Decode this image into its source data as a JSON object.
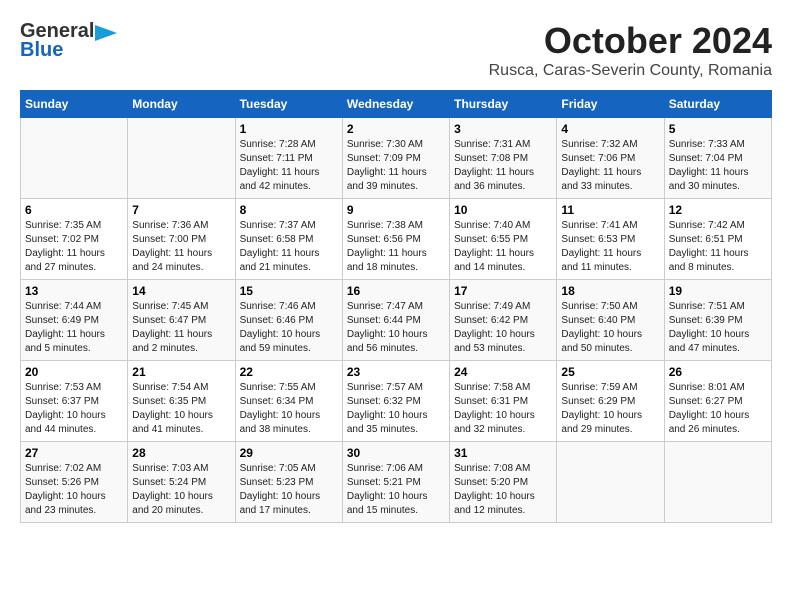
{
  "header": {
    "logo": {
      "line1": "General",
      "line2": "Blue"
    },
    "title": "October 2024",
    "subtitle": "Rusca, Caras-Severin County, Romania"
  },
  "weekdays": [
    "Sunday",
    "Monday",
    "Tuesday",
    "Wednesday",
    "Thursday",
    "Friday",
    "Saturday"
  ],
  "weeks": [
    [
      {
        "day": "",
        "info": ""
      },
      {
        "day": "",
        "info": ""
      },
      {
        "day": "1",
        "info": "Sunrise: 7:28 AM\nSunset: 7:11 PM\nDaylight: 11 hours and 42 minutes."
      },
      {
        "day": "2",
        "info": "Sunrise: 7:30 AM\nSunset: 7:09 PM\nDaylight: 11 hours and 39 minutes."
      },
      {
        "day": "3",
        "info": "Sunrise: 7:31 AM\nSunset: 7:08 PM\nDaylight: 11 hours and 36 minutes."
      },
      {
        "day": "4",
        "info": "Sunrise: 7:32 AM\nSunset: 7:06 PM\nDaylight: 11 hours and 33 minutes."
      },
      {
        "day": "5",
        "info": "Sunrise: 7:33 AM\nSunset: 7:04 PM\nDaylight: 11 hours and 30 minutes."
      }
    ],
    [
      {
        "day": "6",
        "info": "Sunrise: 7:35 AM\nSunset: 7:02 PM\nDaylight: 11 hours and 27 minutes."
      },
      {
        "day": "7",
        "info": "Sunrise: 7:36 AM\nSunset: 7:00 PM\nDaylight: 11 hours and 24 minutes."
      },
      {
        "day": "8",
        "info": "Sunrise: 7:37 AM\nSunset: 6:58 PM\nDaylight: 11 hours and 21 minutes."
      },
      {
        "day": "9",
        "info": "Sunrise: 7:38 AM\nSunset: 6:56 PM\nDaylight: 11 hours and 18 minutes."
      },
      {
        "day": "10",
        "info": "Sunrise: 7:40 AM\nSunset: 6:55 PM\nDaylight: 11 hours and 14 minutes."
      },
      {
        "day": "11",
        "info": "Sunrise: 7:41 AM\nSunset: 6:53 PM\nDaylight: 11 hours and 11 minutes."
      },
      {
        "day": "12",
        "info": "Sunrise: 7:42 AM\nSunset: 6:51 PM\nDaylight: 11 hours and 8 minutes."
      }
    ],
    [
      {
        "day": "13",
        "info": "Sunrise: 7:44 AM\nSunset: 6:49 PM\nDaylight: 11 hours and 5 minutes."
      },
      {
        "day": "14",
        "info": "Sunrise: 7:45 AM\nSunset: 6:47 PM\nDaylight: 11 hours and 2 minutes."
      },
      {
        "day": "15",
        "info": "Sunrise: 7:46 AM\nSunset: 6:46 PM\nDaylight: 10 hours and 59 minutes."
      },
      {
        "day": "16",
        "info": "Sunrise: 7:47 AM\nSunset: 6:44 PM\nDaylight: 10 hours and 56 minutes."
      },
      {
        "day": "17",
        "info": "Sunrise: 7:49 AM\nSunset: 6:42 PM\nDaylight: 10 hours and 53 minutes."
      },
      {
        "day": "18",
        "info": "Sunrise: 7:50 AM\nSunset: 6:40 PM\nDaylight: 10 hours and 50 minutes."
      },
      {
        "day": "19",
        "info": "Sunrise: 7:51 AM\nSunset: 6:39 PM\nDaylight: 10 hours and 47 minutes."
      }
    ],
    [
      {
        "day": "20",
        "info": "Sunrise: 7:53 AM\nSunset: 6:37 PM\nDaylight: 10 hours and 44 minutes."
      },
      {
        "day": "21",
        "info": "Sunrise: 7:54 AM\nSunset: 6:35 PM\nDaylight: 10 hours and 41 minutes."
      },
      {
        "day": "22",
        "info": "Sunrise: 7:55 AM\nSunset: 6:34 PM\nDaylight: 10 hours and 38 minutes."
      },
      {
        "day": "23",
        "info": "Sunrise: 7:57 AM\nSunset: 6:32 PM\nDaylight: 10 hours and 35 minutes."
      },
      {
        "day": "24",
        "info": "Sunrise: 7:58 AM\nSunset: 6:31 PM\nDaylight: 10 hours and 32 minutes."
      },
      {
        "day": "25",
        "info": "Sunrise: 7:59 AM\nSunset: 6:29 PM\nDaylight: 10 hours and 29 minutes."
      },
      {
        "day": "26",
        "info": "Sunrise: 8:01 AM\nSunset: 6:27 PM\nDaylight: 10 hours and 26 minutes."
      }
    ],
    [
      {
        "day": "27",
        "info": "Sunrise: 7:02 AM\nSunset: 5:26 PM\nDaylight: 10 hours and 23 minutes."
      },
      {
        "day": "28",
        "info": "Sunrise: 7:03 AM\nSunset: 5:24 PM\nDaylight: 10 hours and 20 minutes."
      },
      {
        "day": "29",
        "info": "Sunrise: 7:05 AM\nSunset: 5:23 PM\nDaylight: 10 hours and 17 minutes."
      },
      {
        "day": "30",
        "info": "Sunrise: 7:06 AM\nSunset: 5:21 PM\nDaylight: 10 hours and 15 minutes."
      },
      {
        "day": "31",
        "info": "Sunrise: 7:08 AM\nSunset: 5:20 PM\nDaylight: 10 hours and 12 minutes."
      },
      {
        "day": "",
        "info": ""
      },
      {
        "day": "",
        "info": ""
      }
    ]
  ]
}
